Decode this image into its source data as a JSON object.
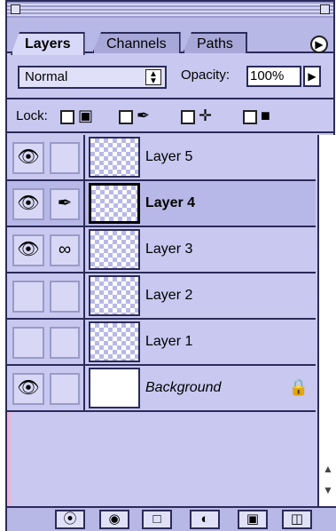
{
  "tabs": [
    {
      "label": "Layers",
      "active": true
    },
    {
      "label": "Channels",
      "active": false
    },
    {
      "label": "Paths",
      "active": false
    }
  ],
  "panel_menu_icon": "triangle-right-icon",
  "blend_mode": "Normal",
  "opacity": {
    "label": "Opacity:",
    "value": "100%"
  },
  "lock": {
    "label": "Lock:"
  },
  "layers": [
    {
      "name": "Layer 5",
      "visible": true,
      "link": "",
      "selected": false
    },
    {
      "name": "Layer 4",
      "visible": true,
      "link": "brush-icon",
      "selected": true
    },
    {
      "name": "Layer 3",
      "visible": true,
      "link": "chain-link-icon",
      "selected": false
    },
    {
      "name": "Layer 2",
      "visible": false,
      "link": "",
      "selected": false
    },
    {
      "name": "Layer 1",
      "visible": false,
      "link": "",
      "selected": false
    },
    {
      "name": "Background",
      "visible": true,
      "link": "",
      "selected": false,
      "locked": true
    }
  ],
  "toolbar_icons": [
    "layer-style-icon",
    "mask-icon",
    "folder-icon",
    "adjustment-layer-icon",
    "new-layer-icon",
    "trash-icon"
  ],
  "colors": {
    "panel": "#c8c8f0",
    "border": "#2b2b5a",
    "selected": "#b8b8e8"
  }
}
